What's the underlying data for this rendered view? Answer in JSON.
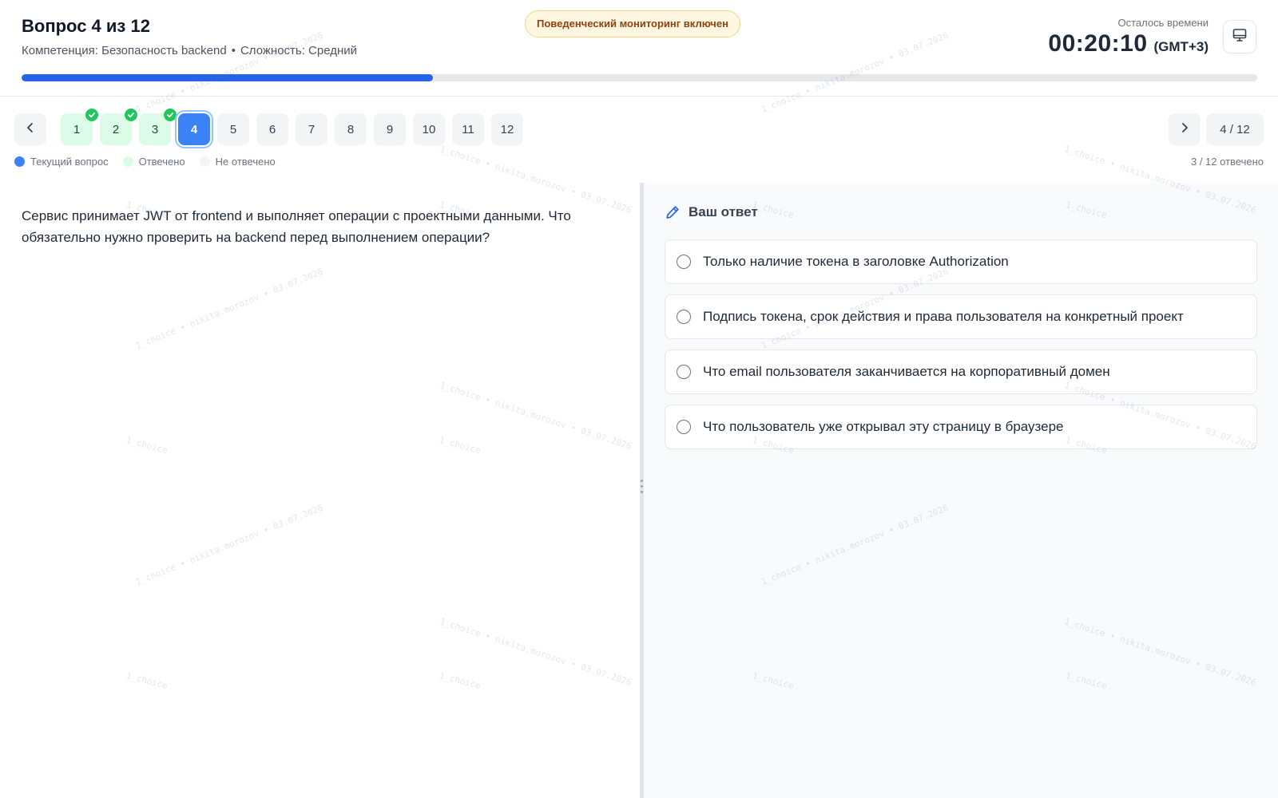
{
  "header": {
    "title": "Вопрос 4 из 12",
    "competency": "Компетенция: Безопасность backend",
    "separator": "•",
    "difficulty": "Сложность: Средний",
    "monitoring_badge": "Поведенческий мониторинг включен",
    "time_label": "Осталось времени",
    "timer_value": "00:20:10",
    "timezone": "(GMT+3)",
    "screen_icon": "monitor-icon",
    "progress_fraction": 0.333
  },
  "navigation": {
    "prev_icon": "chevron-left-icon",
    "next_icon": "chevron-right-icon",
    "questions": [
      {
        "label": "1",
        "state": "answered"
      },
      {
        "label": "2",
        "state": "answered"
      },
      {
        "label": "3",
        "state": "answered"
      },
      {
        "label": "4",
        "state": "current"
      },
      {
        "label": "5",
        "state": "unanswered"
      },
      {
        "label": "6",
        "state": "unanswered"
      },
      {
        "label": "7",
        "state": "unanswered"
      },
      {
        "label": "8",
        "state": "unanswered"
      },
      {
        "label": "9",
        "state": "unanswered"
      },
      {
        "label": "10",
        "state": "unanswered"
      },
      {
        "label": "11",
        "state": "unanswered"
      },
      {
        "label": "12",
        "state": "unanswered"
      }
    ],
    "page_counter": "4 / 12",
    "answered_count": "3 / 12 отвечено"
  },
  "legend": {
    "current": {
      "label": "Текущий вопрос",
      "color": "#3b82f6"
    },
    "answered": {
      "label": "Отвечено",
      "color": "#dcfce7"
    },
    "unanswered": {
      "label": "Не отвечено",
      "color": "#f3f4f6"
    }
  },
  "question": {
    "text": "Сервис принимает JWT от frontend и выполняет операции с проектными данными. Что обязательно нужно проверить на backend перед выполнением операции?"
  },
  "answer": {
    "heading": "Ваш ответ",
    "heading_icon": "pencil-icon",
    "options": [
      {
        "label": "Только наличие токена в заголовке Authorization",
        "selected": false
      },
      {
        "label": "Подпись токена, срок действия и права пользователя на конкретный проект",
        "selected": false
      },
      {
        "label": "Что email пользователя заканчивается на корпоративный домен",
        "selected": false
      },
      {
        "label": "Что пользователь уже открывал эту страницу в браузере",
        "selected": false
      }
    ]
  },
  "watermark": {
    "full": "1_choice • nikita.morozov • 03.07.2026",
    "short": "1_choice"
  },
  "colors": {
    "accent": "#2563eb",
    "answered_check": "#22c55e",
    "badge_bg": "#fff7e0",
    "badge_text": "#92400e"
  }
}
